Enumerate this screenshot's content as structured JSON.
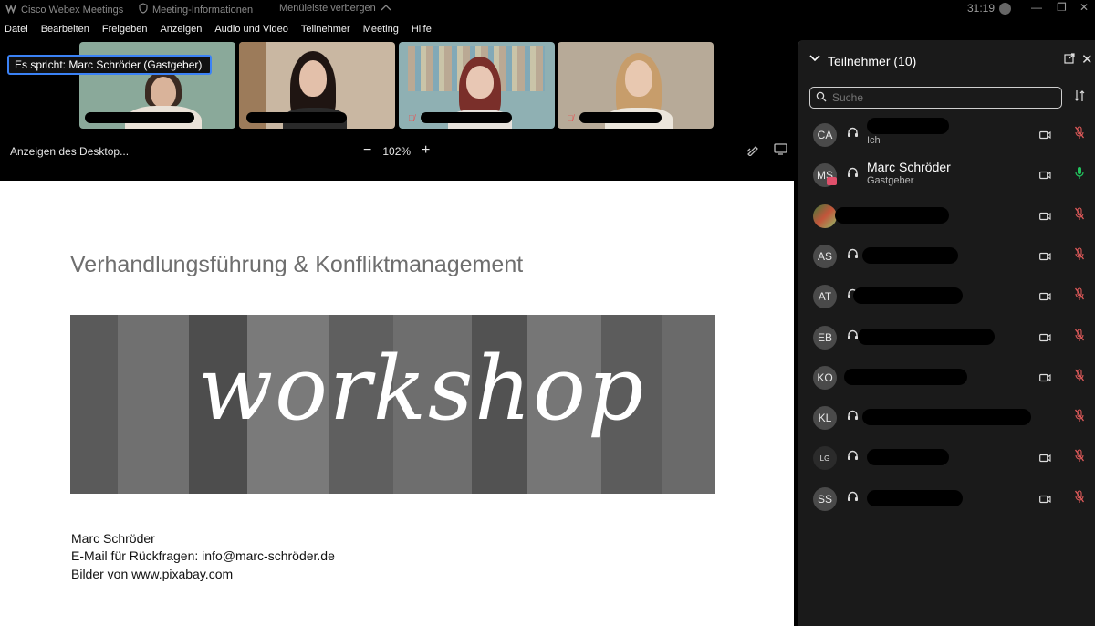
{
  "titlebar": {
    "app_name": "Cisco Webex Meetings",
    "meeting_info": "Meeting-Informationen",
    "hide_menu": "Menüleiste verbergen",
    "timer": "31:19"
  },
  "menu": [
    "Datei",
    "Bearbeiten",
    "Freigeben",
    "Anzeigen",
    "Audio und Video",
    "Teilnehmer",
    "Meeting",
    "Hilfe"
  ],
  "speaker_label": "Es spricht: Marc Schröder (Gastgeber)",
  "toolbar": {
    "desktop_label": "Anzeigen des Desktop...",
    "zoom_out": "−",
    "zoom_level": "102%",
    "zoom_in": "+"
  },
  "slide": {
    "title": "Verhandlungsführung & Konfliktmanagement",
    "banner_word": "workshop",
    "presenter": "Marc Schröder",
    "email_line": "E-Mail für Rückfragen: info@marc-schröder.de",
    "images_line": "Bilder von www.pixabay.com"
  },
  "panel": {
    "title": "Teilnehmer (10)",
    "search_placeholder": "Suche",
    "participants": [
      {
        "initials": "CA",
        "name": "",
        "sub": "Ich",
        "mic": "muted",
        "camera": true
      },
      {
        "initials": "MS",
        "name": "Marc Schröder",
        "sub": "Gastgeber",
        "mic": "active",
        "camera": true
      },
      {
        "initials": "",
        "name": "",
        "sub": "",
        "mic": "muted",
        "camera": true
      },
      {
        "initials": "AS",
        "name": "",
        "sub": "",
        "mic": "muted",
        "camera": true
      },
      {
        "initials": "AT",
        "name": "",
        "sub": "",
        "mic": "muted",
        "camera": true
      },
      {
        "initials": "EB",
        "name": "",
        "sub": "",
        "mic": "muted",
        "camera": true
      },
      {
        "initials": "KO",
        "name": "",
        "sub": "",
        "mic": "muted",
        "camera": true
      },
      {
        "initials": "KL",
        "name": "",
        "sub": "",
        "mic": "muted",
        "camera": false
      },
      {
        "initials": "LG",
        "name": "",
        "sub": "",
        "mic": "muted",
        "camera": true
      },
      {
        "initials": "SS",
        "name": "",
        "sub": "",
        "mic": "muted",
        "camera": true
      }
    ]
  },
  "colors": {
    "accent": "#3b82f6",
    "muted_mic": "#e05a5a",
    "active_mic": "#22c55e",
    "panel_bg": "#1a1a1a"
  }
}
